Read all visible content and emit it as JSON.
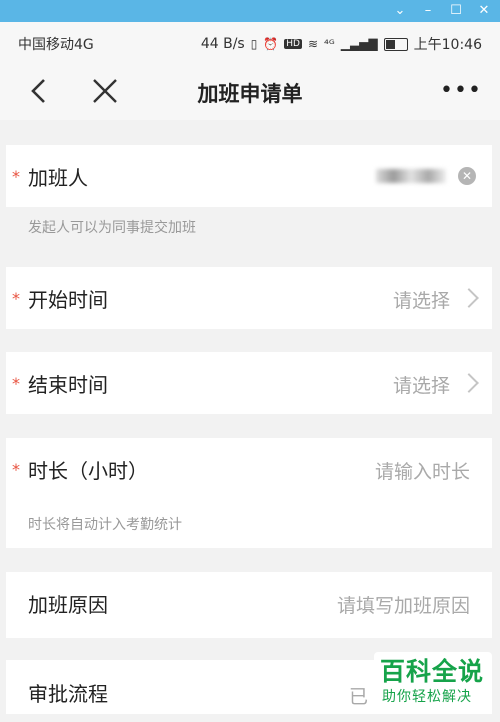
{
  "status_bar": {
    "carrier": "中国移动4G",
    "speed": "44 B/s",
    "hd": "HD",
    "net": "⁴ᴳ",
    "time": "上午10:46"
  },
  "header": {
    "title": "加班申请单",
    "more_label": "•••"
  },
  "form": {
    "person": {
      "label": "加班人",
      "hint": "发起人可以为同事提交加班"
    },
    "start": {
      "label": "开始时间",
      "placeholder": "请选择"
    },
    "end": {
      "label": "结束时间",
      "placeholder": "请选择"
    },
    "duration": {
      "label": "时长（小时）",
      "placeholder": "请输入时长",
      "hint": "时长将自动计入考勤统计"
    },
    "reason": {
      "label": "加班原因",
      "placeholder": "请填写加班原因"
    },
    "approval": {
      "label": "审批流程",
      "value": "已"
    },
    "required_mark": "*"
  },
  "watermark": {
    "title": "百科全说",
    "subtitle": "助你轻松解决"
  },
  "colors": {
    "window_bar": "#5ab6e6",
    "required": "#e8523f",
    "watermark": "#16a34a"
  }
}
